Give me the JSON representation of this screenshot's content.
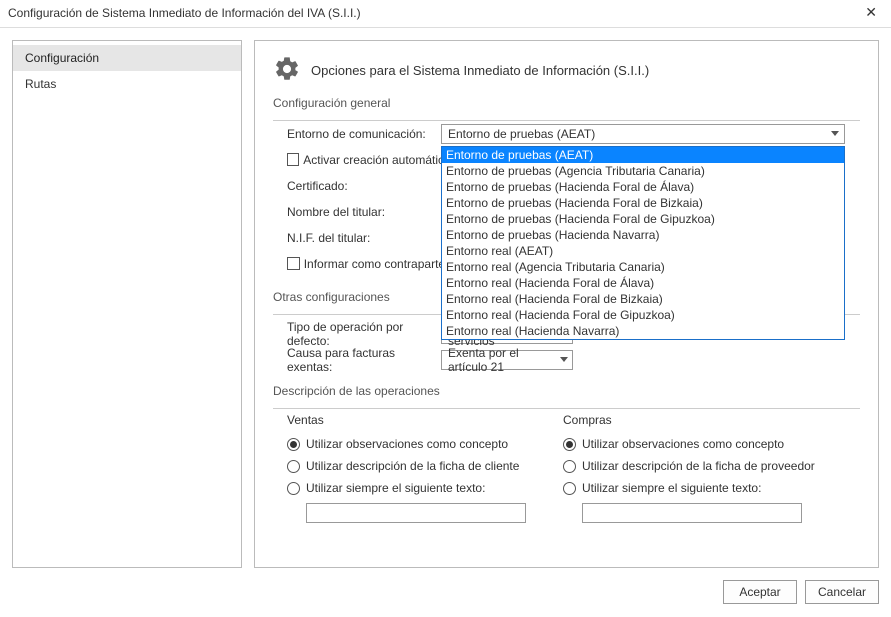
{
  "window": {
    "title": "Configuración de Sistema Inmediato de Información del IVA (S.I.I.)"
  },
  "sidebar": {
    "items": [
      {
        "label": "Configuración",
        "selected": true
      },
      {
        "label": "Rutas",
        "selected": false
      }
    ]
  },
  "header": {
    "title": "Opciones para el Sistema Inmediato de Información (S.I.I.)"
  },
  "sections": {
    "general": {
      "title": "Configuración general",
      "entorno_label": "Entorno de comunicación:",
      "entorno_value": "Entorno de pruebas (AEAT)",
      "entorno_options": [
        "Entorno de pruebas (AEAT)",
        "Entorno de pruebas (Agencia Tributaria Canaria)",
        "Entorno de pruebas (Hacienda Foral de Álava)",
        "Entorno de pruebas (Hacienda Foral de Bizkaia)",
        "Entorno de pruebas (Hacienda Foral de Gipuzkoa)",
        "Entorno de pruebas (Hacienda Navarra)",
        "Entorno real (AEAT)",
        "Entorno real (Agencia Tributaria Canaria)",
        "Entorno real (Hacienda Foral de Álava)",
        "Entorno real (Hacienda Foral de Bizkaia)",
        "Entorno real (Hacienda Foral de Gipuzkoa)",
        "Entorno real (Hacienda Navarra)"
      ],
      "activar_label": "Activar creación automática",
      "certificado_label": "Certificado:",
      "nombre_label": "Nombre del titular:",
      "nif_label": "N.I.F. del titular:",
      "informar_label": "Informar como contraparte"
    },
    "otras": {
      "title": "Otras configuraciones",
      "tipo_label": "Tipo de operación por defecto:",
      "tipo_value": "Prestación de servicios",
      "causa_label": "Causa para facturas exentas:",
      "causa_value": "Exenta por el artículo 21"
    },
    "descripcion": {
      "title": "Descripción de las operaciones",
      "ventas": {
        "heading": "Ventas",
        "opt1": "Utilizar observaciones como concepto",
        "opt2": "Utilizar descripción de la ficha de cliente",
        "opt3": "Utilizar siempre el siguiente texto:"
      },
      "compras": {
        "heading": "Compras",
        "opt1": "Utilizar observaciones como concepto",
        "opt2": "Utilizar descripción de la ficha de proveedor",
        "opt3": "Utilizar siempre el siguiente texto:"
      }
    }
  },
  "footer": {
    "accept": "Aceptar",
    "cancel": "Cancelar"
  }
}
